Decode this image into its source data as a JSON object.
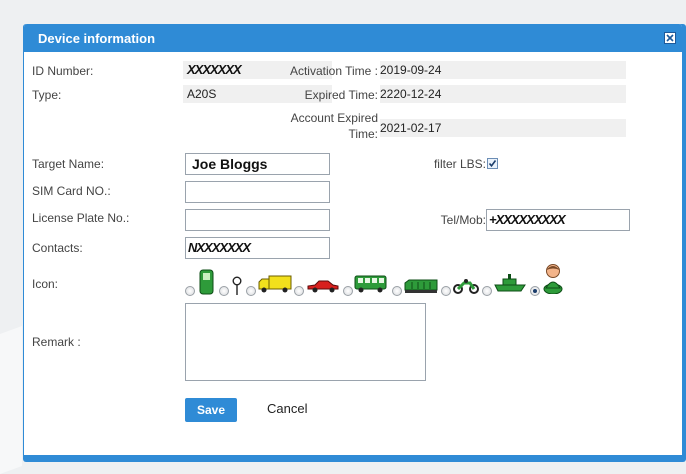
{
  "dialog": {
    "title": "Device information",
    "close_icon": "close-icon"
  },
  "fields": {
    "id_number": {
      "label": "ID Number:",
      "value": "XXXXXXX"
    },
    "type": {
      "label": "Type:",
      "value": "A20S"
    },
    "activation_time": {
      "label": "Activation Time :",
      "value": "2019-09-24"
    },
    "expired_time": {
      "label": "Expired Time:",
      "value": "2220-12-24"
    },
    "account_expired_time": {
      "label_line1": "Account Expired",
      "label_line2": "Time:",
      "value": "2021-02-17"
    },
    "target_name": {
      "label": "Target Name:",
      "value": "Joe Bloggs"
    },
    "filter_lbs": {
      "label": "filter LBS:",
      "checked": true
    },
    "sim_card": {
      "label": "SIM Card NO.:",
      "value": ""
    },
    "license_plate": {
      "label": "License Plate No.:",
      "value": ""
    },
    "tel_mob": {
      "label": "Tel/Mob:",
      "value": "+XXXXXXXXX"
    },
    "contacts": {
      "label": "Contacts:",
      "value": "NXXXXXXX"
    },
    "icon": {
      "label": "Icon:",
      "options": [
        "fuel-pump-icon",
        "map-pin-icon",
        "truck-icon",
        "car-icon",
        "bus-icon",
        "train-icon",
        "motorcycle-icon",
        "ship-icon",
        "person-icon"
      ],
      "selected": "person-icon"
    },
    "remark": {
      "label": "Remark :",
      "value": ""
    }
  },
  "buttons": {
    "save": "Save",
    "cancel": "Cancel"
  },
  "colors": {
    "accent": "#2f8bd6",
    "field_bg": "#f0f0f0"
  }
}
